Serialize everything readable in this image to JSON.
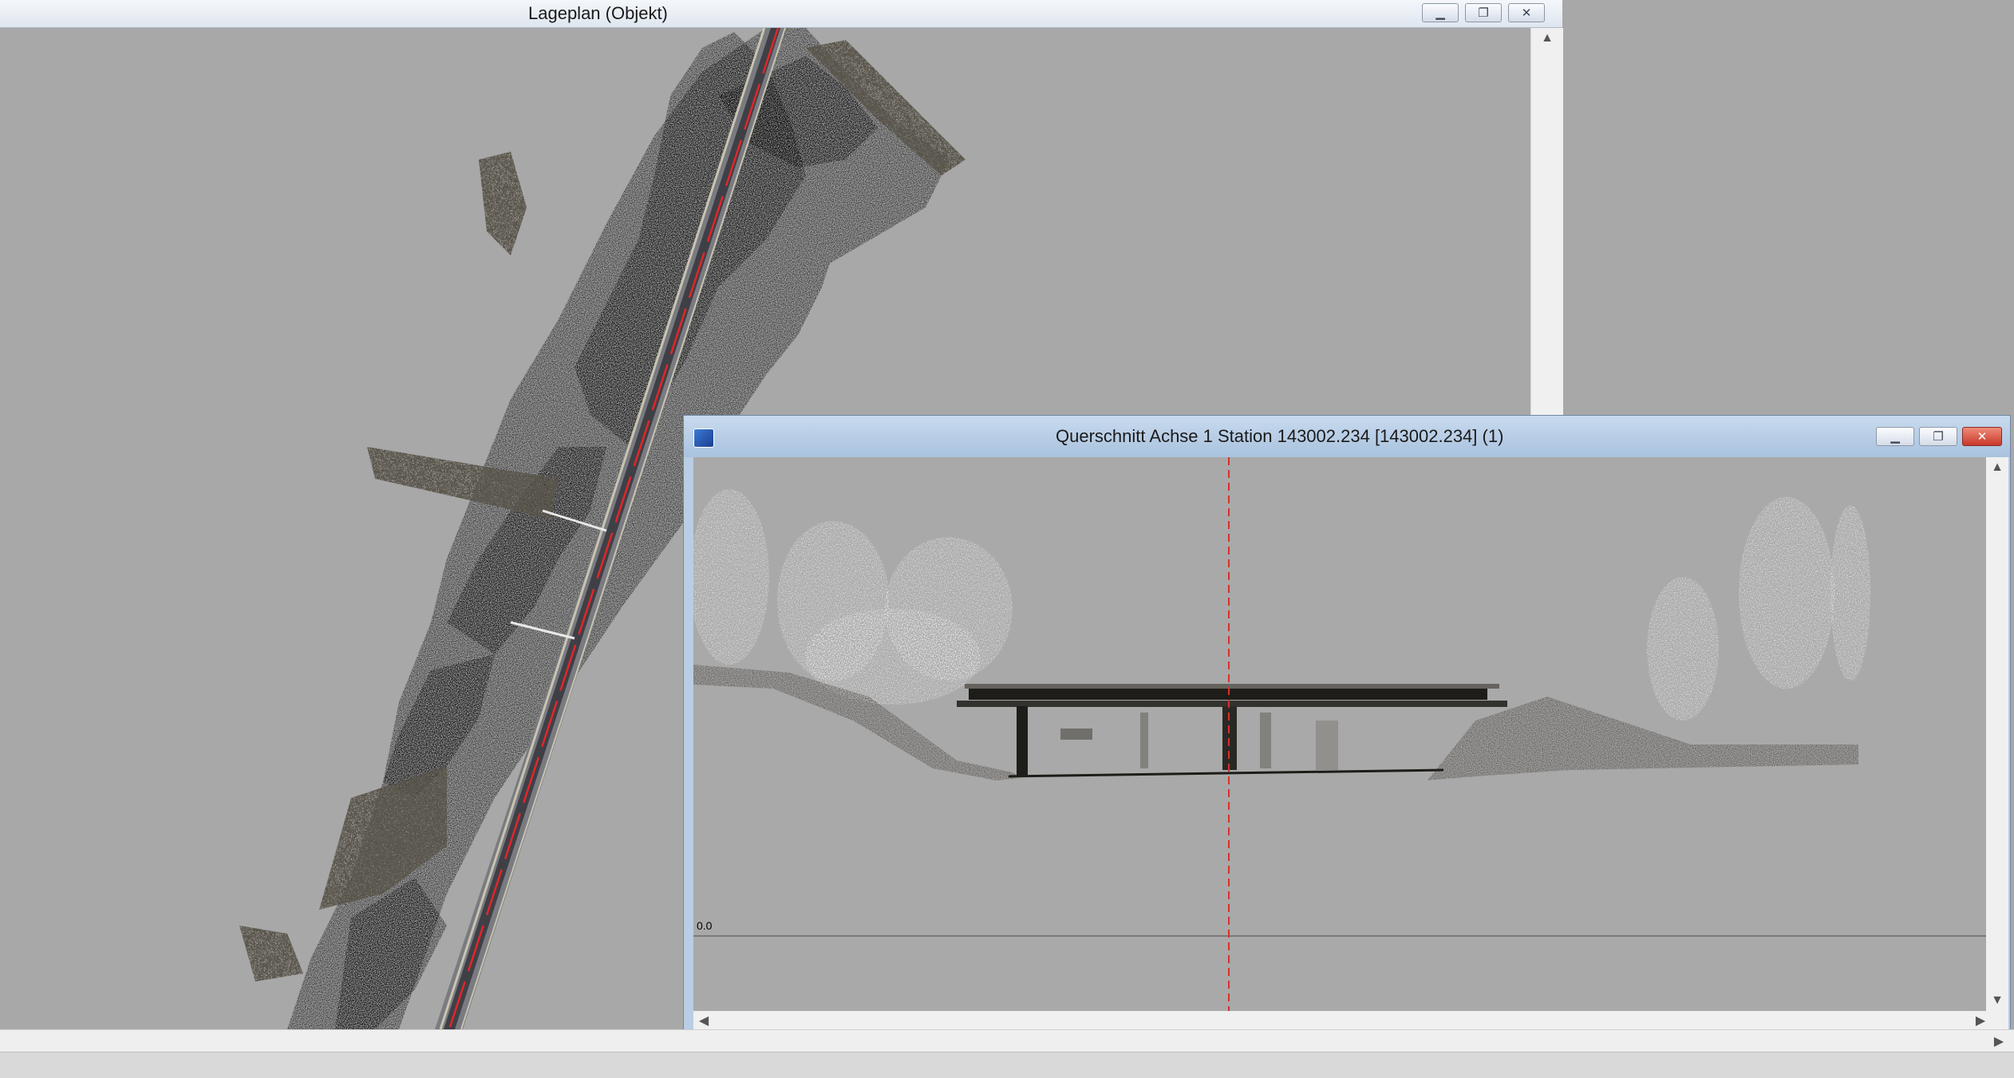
{
  "lageplan_window": {
    "title": "Lageplan (Objekt)",
    "controls": {
      "minimize_icon": "minimize-icon",
      "restore_icon": "restore-icon",
      "close_icon": "close-icon"
    }
  },
  "querschnitt_window": {
    "title": "Querschnitt Achse 1 Station 143002.234 [143002.234] (1)",
    "baseline_label": "0.0",
    "controls": {
      "minimize_icon": "minimize-icon",
      "restore_icon": "restore-icon",
      "close_icon": "close-icon"
    }
  },
  "colors": {
    "workspace_bg": "#a8a8a8",
    "station_line": "#d9302a",
    "track_red": "#e2262a",
    "vegetation": "#7f8a45"
  }
}
